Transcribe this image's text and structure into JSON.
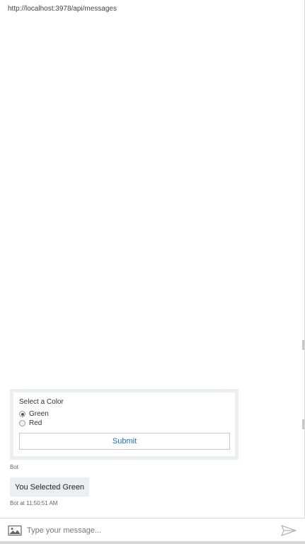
{
  "window": {
    "url": "http://localhost:3978/api/messages"
  },
  "card": {
    "title": "Select a Color",
    "options": [
      {
        "label": "Green",
        "checked": true
      },
      {
        "label": "Red",
        "checked": false
      }
    ],
    "submit_label": "Submit"
  },
  "card_sender": "Bot",
  "message": {
    "text": "You Selected Green",
    "meta": "Bot at 11:50:51 AM"
  },
  "input": {
    "placeholder": "Type your message...",
    "value": ""
  },
  "icons": {
    "upload": "image-upload-icon",
    "send": "send-icon"
  },
  "colors": {
    "bubble_bg": "#eceff2",
    "link_blue": "#1a6fb5"
  }
}
